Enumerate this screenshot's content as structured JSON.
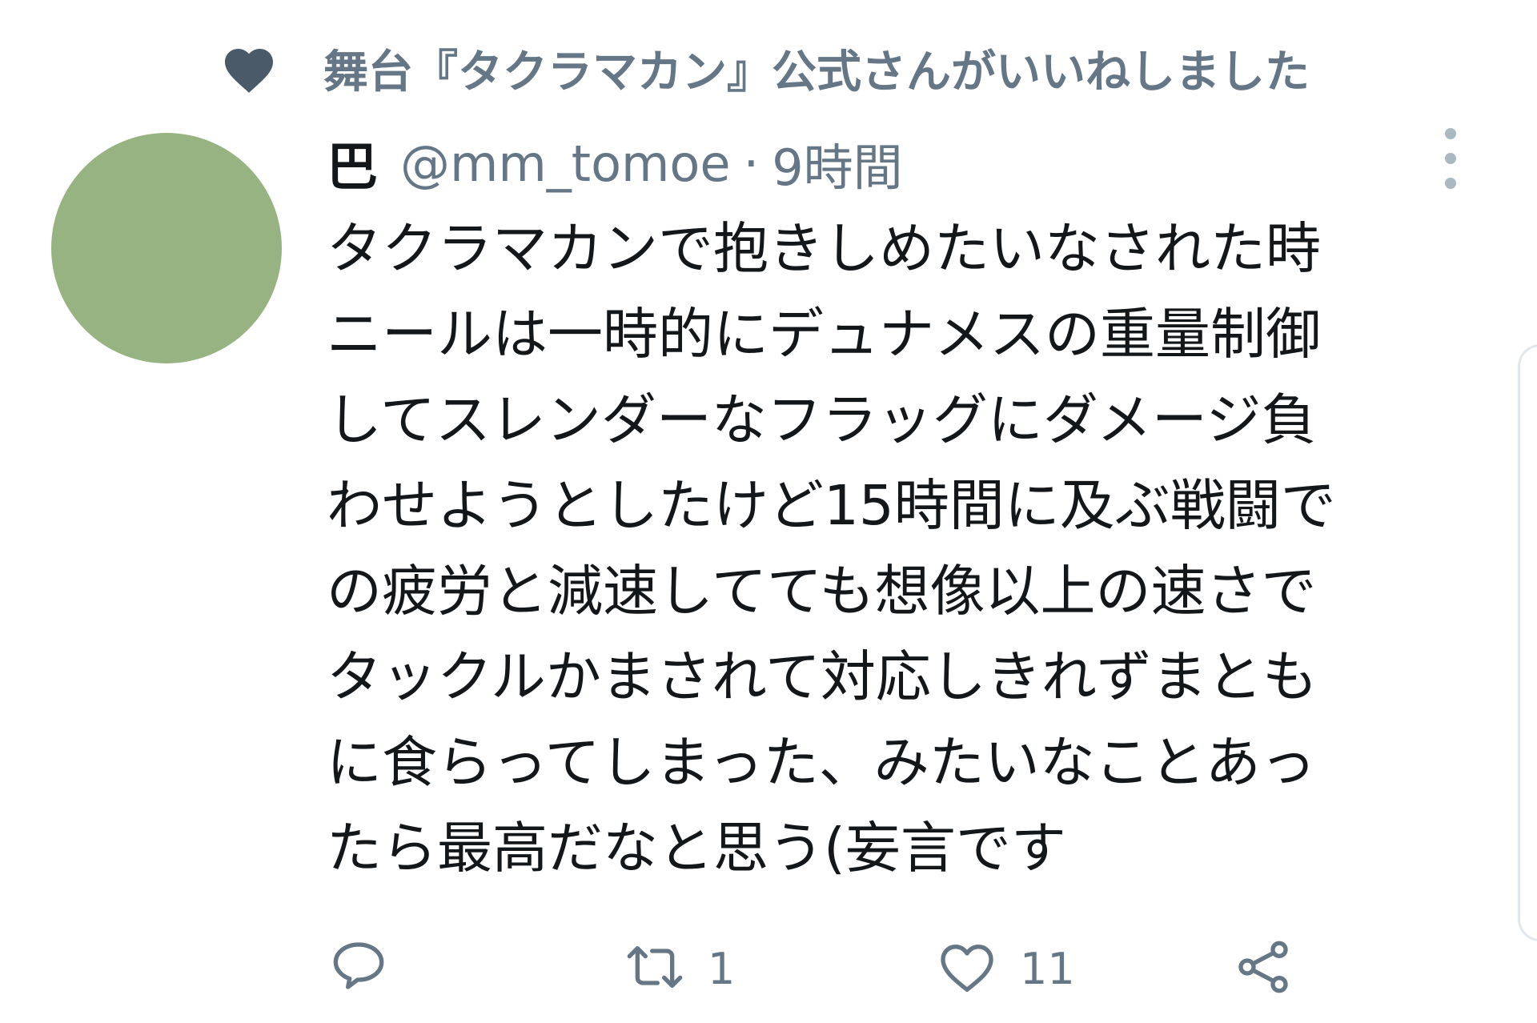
{
  "context": {
    "icon": "heart-icon",
    "text": "舞台『タクラマカン』公式さんがいいねしました"
  },
  "author": {
    "display_name": "巴",
    "handle": "@mm_tomoe",
    "separator": "·",
    "time": "9時間"
  },
  "body": {
    "lines": [
      "タクラマカンで抱きしめたいなされた時",
      "ニールは一時的にデュナメスの重量制御",
      "してスレンダーなフラッグにダメージ負",
      "わせようとしたけど15時間に及ぶ戦闘で",
      "の疲労と減速してても想像以上の速さで",
      "タックルかまされて対応しきれずまとも",
      "に食らってしまった、みたいなことあっ",
      "たら最高だなと思う(妄言です"
    ]
  },
  "actions": {
    "reply": {
      "icon": "reply-icon",
      "count": ""
    },
    "retweet": {
      "icon": "retweet-icon",
      "count": "1"
    },
    "like": {
      "icon": "heart-outline-icon",
      "count": "11"
    },
    "share": {
      "icon": "share-icon"
    }
  },
  "colors": {
    "avatar": "#98b382",
    "muted": "#657786",
    "text": "#14171a"
  }
}
